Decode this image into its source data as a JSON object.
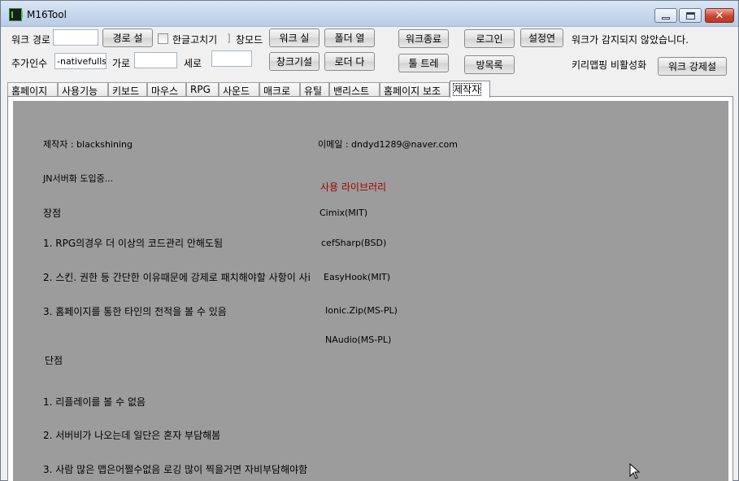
{
  "window": {
    "title": "M16Tool"
  },
  "toolbar": {
    "work_path_label": "워크 경로",
    "work_path_value": "",
    "path_set_button": "경로 설",
    "korean_fix_label": "한글고치기",
    "window_mode_label": "창모드",
    "work_run_button": "워크 실",
    "folder_open_button": "폴더 열",
    "work_exit_button": "워크종료",
    "login_button": "로그인",
    "settings_button": "설정연",
    "status_text": "워크가 감지되지 않았습니다.",
    "extra_args_label": "추가인수",
    "extra_args_value": "-nativefullscr",
    "width_label": "가로",
    "width_value": "",
    "height_label": "세로",
    "height_value": "",
    "window_func_button": "창크기설",
    "loader_button": "로더 다",
    "tool_tray_button": "툴 트레",
    "list_button": "방목록",
    "keymap_disable_label": "키리맵핑 비활성화",
    "work_force_button": "워크 강제설"
  },
  "tabs": [
    {
      "label": "홈페이지"
    },
    {
      "label": "사용기능"
    },
    {
      "label": "키보드"
    },
    {
      "label": "마우스"
    },
    {
      "label": "RPG"
    },
    {
      "label": "사운드"
    },
    {
      "label": "매크로"
    },
    {
      "label": "유틸"
    },
    {
      "label": "밴리스트"
    },
    {
      "label": "홈페이지 보조"
    },
    {
      "label": "제작자"
    }
  ],
  "content": {
    "author": "제작자 : blackshining",
    "email": "이메일 : dndyd1289@naver.com",
    "jn_server": "JN서버화 도입중...",
    "libraries_title": "사용 라이브러리",
    "pros_title": "장점",
    "lib1": "Cimix(MIT)",
    "pro1": "1. RPG의경우 더 이상의 코드관리 안해도됨",
    "lib2": "cefSharp(BSD)",
    "pro2": "2. 스킨. 권한 등 간단한 이유때문에 강제로 패치해야할 사항이 사i",
    "lib3": "EasyHook(MIT)",
    "pro3": "3. 홈페이지를 통한 타인의 전적을 볼 수 있음",
    "lib4": "Ionic.Zip(MS-PL)",
    "lib5": "NAudio(MS-PL)",
    "cons_title": "단점",
    "con1": "1. 리플레이를 볼 수 없음",
    "con2": "2. 서버비가 나오는데 일단은 혼자 부담해봄",
    "con3": "3. 사람 많은 맵은어쩔수없음 로깅 많이 찍을거면 자비부담해야함"
  },
  "colors": {
    "content_bg": "#9c9c9c",
    "library_title": "#a00000"
  }
}
